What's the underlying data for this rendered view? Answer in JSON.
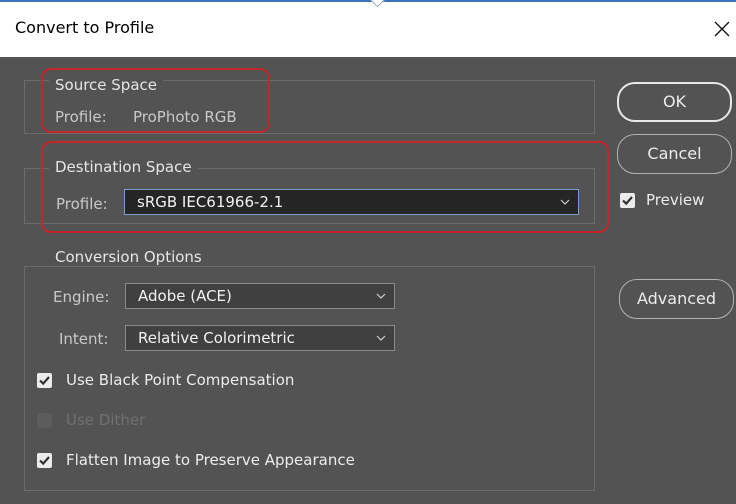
{
  "window": {
    "title": "Convert to Profile",
    "close_glyph": "✕"
  },
  "source_space": {
    "title": "Source Space",
    "profile_label": "Profile:",
    "profile_value": "ProPhoto RGB"
  },
  "destination_space": {
    "title": "Destination Space",
    "profile_label": "Profile:",
    "profile_value": "sRGB IEC61966-2.1"
  },
  "conversion_options": {
    "title": "Conversion Options",
    "engine_label": "Engine:",
    "engine_value": "Adobe (ACE)",
    "intent_label": "Intent:",
    "intent_value": "Relative Colorimetric",
    "black_point": {
      "label": "Use Black Point Compensation",
      "checked": true
    },
    "dither": {
      "label": "Use Dither",
      "checked": false,
      "disabled": true
    },
    "flatten": {
      "label": "Flatten Image to Preserve Appearance",
      "checked": true
    }
  },
  "buttons": {
    "ok": "OK",
    "cancel": "Cancel",
    "advanced": "Advanced"
  },
  "preview": {
    "label": "Preview",
    "checked": true
  },
  "colors": {
    "dialog_bg": "#535353",
    "highlight": "#c1272d",
    "titlebar_bg": "#ffffff"
  }
}
